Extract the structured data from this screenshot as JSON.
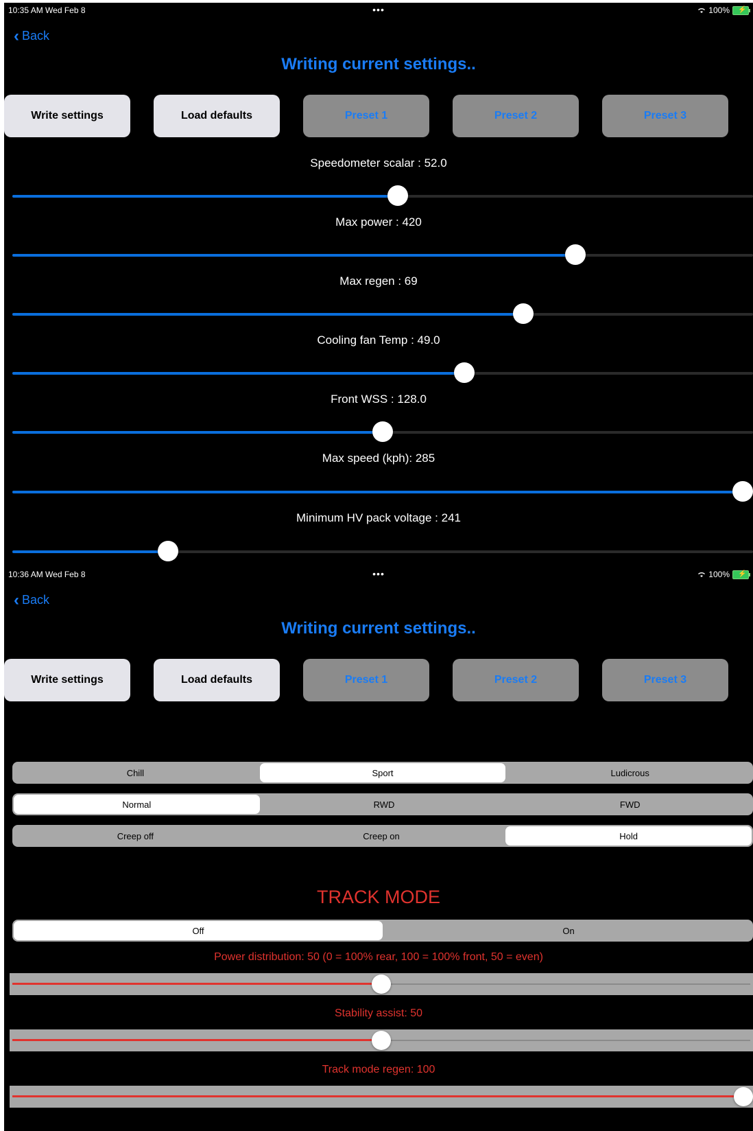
{
  "screen1": {
    "status": {
      "time": "10:35 AM  Wed Feb 8",
      "dots": "•••",
      "battery": "100%"
    },
    "back_label": "Back",
    "title": "Writing current settings..",
    "buttons": {
      "write": "Write settings",
      "load": "Load defaults",
      "preset1": "Preset 1",
      "preset2": "Preset 2",
      "preset3": "Preset 3"
    },
    "sliders": [
      {
        "label": "Speedometer scalar : 52.0",
        "fraction": 0.52
      },
      {
        "label": "Max power : 420",
        "fraction": 0.76
      },
      {
        "label": "Max regen : 69",
        "fraction": 0.69
      },
      {
        "label": "Cooling fan Temp : 49.0",
        "fraction": 0.61
      },
      {
        "label": "Front WSS : 128.0",
        "fraction": 0.5
      },
      {
        "label": "Max speed (kph): 285",
        "fraction": 1.0
      },
      {
        "label": "Minimum HV pack voltage : 241",
        "fraction": 0.21
      }
    ]
  },
  "screen2": {
    "status": {
      "time": "10:36 AM  Wed Feb 8",
      "dots": "•••",
      "battery": "100%"
    },
    "back_label": "Back",
    "title": "Writing current settings..",
    "buttons": {
      "write": "Write settings",
      "load": "Load defaults",
      "preset1": "Preset 1",
      "preset2": "Preset 2",
      "preset3": "Preset 3"
    },
    "segments": [
      {
        "options": [
          "Chill",
          "Sport",
          "Ludicrous"
        ],
        "selected": 1
      },
      {
        "options": [
          "Normal",
          "RWD",
          "FWD"
        ],
        "selected": 0
      },
      {
        "options": [
          "Creep off",
          "Creep on",
          "Hold"
        ],
        "selected": 2
      }
    ],
    "track_mode_title": "TRACK MODE",
    "track_toggle": {
      "options": [
        "Off",
        "On"
      ],
      "selected": 0
    },
    "red_sliders": [
      {
        "label": "Power distribution: 50 (0 = 100% rear, 100 = 100% front, 50 = even)",
        "fraction": 0.5
      },
      {
        "label": "Stability assist: 50",
        "fraction": 0.5
      },
      {
        "label": "Track mode regen: 100",
        "fraction": 1.0
      }
    ]
  },
  "colors": {
    "accent": "#1a7cf5",
    "red": "#e0332e",
    "slider_fill": "#0a6edc"
  }
}
